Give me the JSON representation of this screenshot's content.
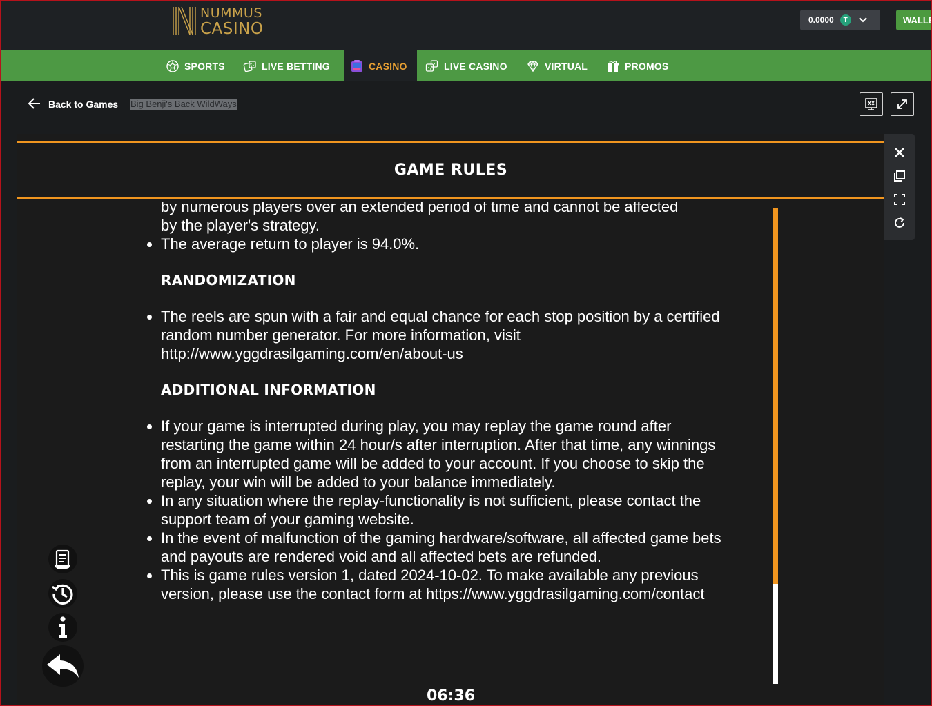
{
  "brand": {
    "line1": "NUMMUS",
    "line2": "CASINO"
  },
  "header": {
    "balance": "0.0000",
    "token_symbol": "T",
    "wallet_label": "WALLET"
  },
  "nav": {
    "items": [
      {
        "label": "SPORTS",
        "icon": "soccer-ball-icon"
      },
      {
        "label": "LIVE BETTING",
        "icon": "dice-cards-icon"
      },
      {
        "label": "CASINO",
        "icon": "slot-machine-icon",
        "active": true
      },
      {
        "label": "LIVE CASINO",
        "icon": "live-dice-icon"
      },
      {
        "label": "VIRTUAL",
        "icon": "diamond-icon"
      },
      {
        "label": "PROMOS",
        "icon": "gift-icon"
      }
    ],
    "active_color": "#e8a033",
    "bar_color": "#4d9944"
  },
  "subheader": {
    "back_label": "Back to Games",
    "game_title": "Big Benji's Back WildWays"
  },
  "rules": {
    "title": "GAME RULES",
    "intro_line1": "by numerous players over an extended period of time and cannot be affected",
    "intro_line2": "by the player's strategy.",
    "rtp": "The average return to player is 94.0%.",
    "randomization_heading": "RANDOMIZATION",
    "randomization_text": "The reels are spun with a fair and equal chance for each stop position by a certified random number generator. For more information, visit http://www.yggdrasilgaming.com/en/about-us",
    "additional_heading": "ADDITIONAL INFORMATION",
    "additional_items": [
      "If your game is interrupted during play, you may replay the game round after restarting the game within 24 hour/s after interruption. After that time, any winnings from an interrupted game will be added to your account. If you choose to skip the replay, your win will be added to your balance immediately.",
      "In any situation where the replay-functionality is not sufficient, please contact the support team of your gaming website.",
      "In the event of malfunction of the gaming hardware/software, all affected game bets and payouts are rendered void and all affected bets are refunded.",
      "This is game rules version 1, dated 2024-10-02. To make available any previous version, please use the contact form at https://www.yggdrasilgaming.com/contact"
    ],
    "accent_color": "#f0951f",
    "scroll_fraction": 0.79
  },
  "timer": "06:36"
}
